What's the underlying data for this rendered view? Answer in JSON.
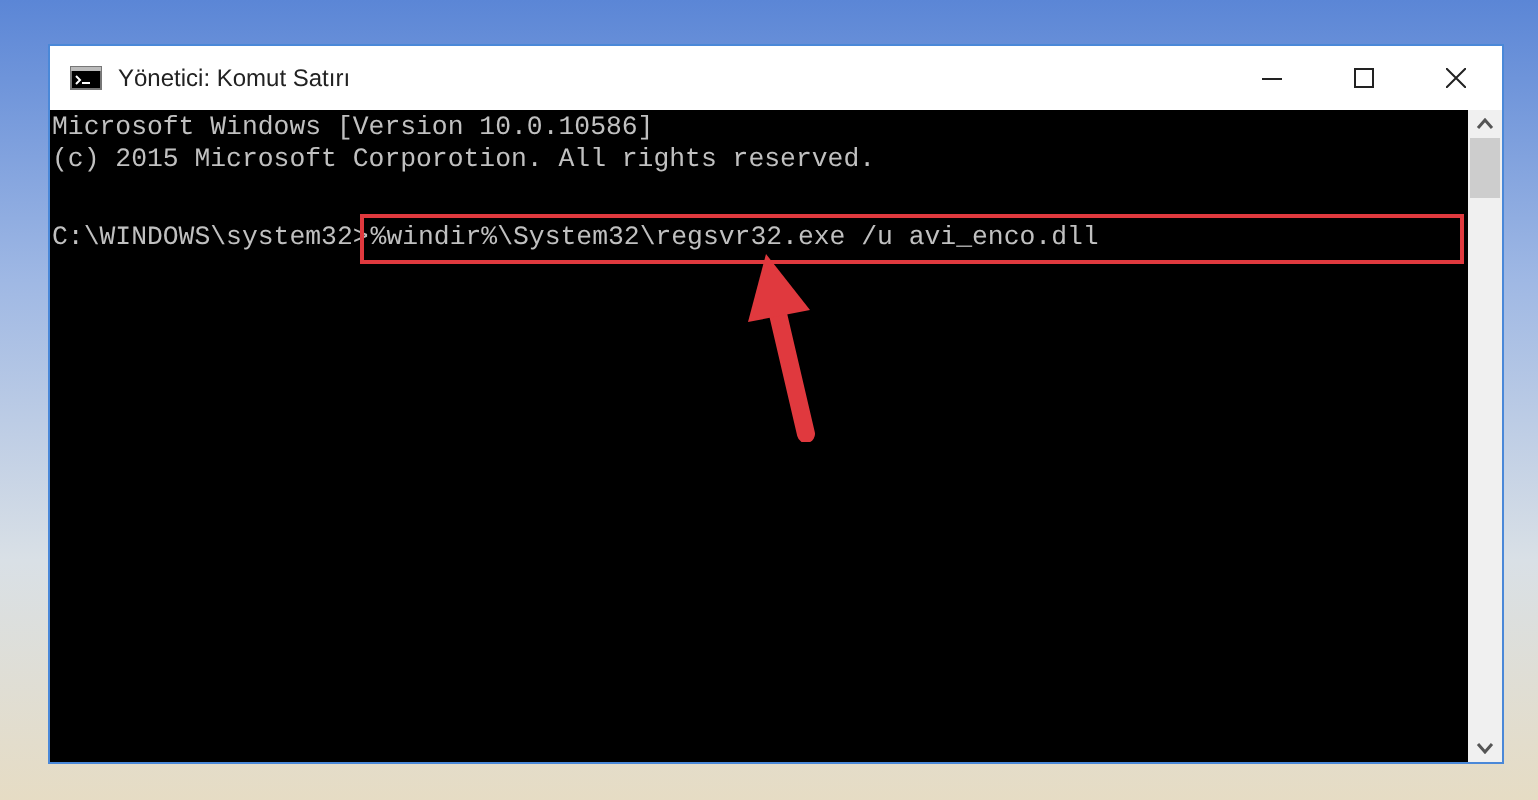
{
  "window": {
    "title": "Yönetici: Komut Satırı"
  },
  "console": {
    "lines": [
      {
        "kind": "output",
        "text": "Microsoft Windows [Version 10.0.10586]"
      },
      {
        "kind": "output",
        "text": "(c) 2015 Microsoft Corporotion. All rights reserved."
      },
      {
        "kind": "blank"
      },
      {
        "kind": "command",
        "prompt": "C:\\WINDOWS\\system32>",
        "text": "%windir%\\System32\\regsvr32.exe /u avi_enco.dll",
        "highlighted": true
      }
    ]
  }
}
